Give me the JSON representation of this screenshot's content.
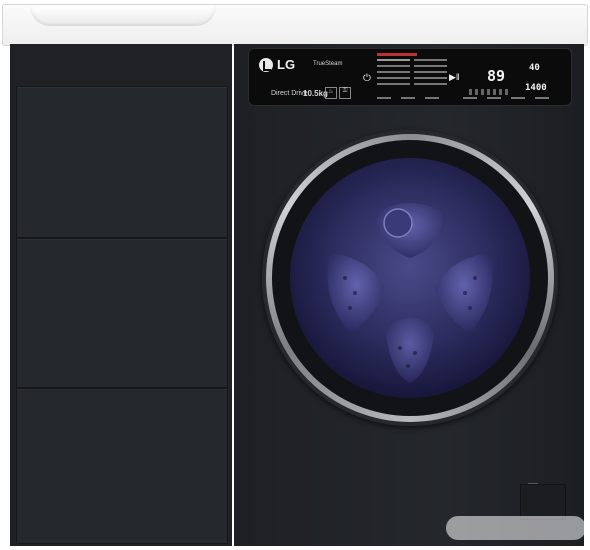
{
  "brand": "LG",
  "truesteam": "TrueSteam",
  "motor_label": "Direct Drive",
  "capacity": "10.5kg",
  "display": {
    "time": "89",
    "temperature": "40",
    "spin": "1400"
  },
  "program_list_header": "",
  "watermark_text": "",
  "colors": {
    "cabinet": "#1f2125",
    "washer_body": "#24272c",
    "panel": "#0b0b0c",
    "glass": "#2c2c5e",
    "door_chrome": "#b8babf",
    "countertop": "#f4f4f4"
  },
  "icons": [
    "lg-logo-icon",
    "power-icon",
    "start-pause-icon",
    "steam-icon",
    "child-lock-icon"
  ]
}
